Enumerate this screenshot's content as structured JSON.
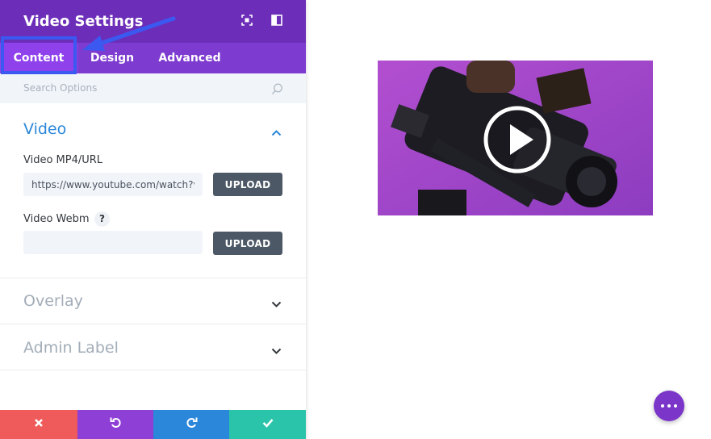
{
  "panel": {
    "title": "Video Settings",
    "tabs": [
      {
        "label": "Content",
        "active": true
      },
      {
        "label": "Design",
        "active": false
      },
      {
        "label": "Advanced",
        "active": false
      }
    ],
    "search": {
      "placeholder": "Search Options"
    },
    "sections": {
      "video": {
        "title": "Video",
        "expanded": true,
        "fields": {
          "mp4": {
            "label": "Video MP4/URL",
            "value": "https://www.youtube.com/watch?v",
            "button": "UPLOAD"
          },
          "webm": {
            "label": "Video Webm",
            "help": "?",
            "value": "",
            "button": "UPLOAD"
          }
        }
      },
      "overlay": {
        "title": "Overlay",
        "expanded": false
      },
      "admin_label": {
        "title": "Admin Label",
        "expanded": false
      }
    },
    "footer": {
      "buttons": [
        {
          "name": "cancel",
          "icon": "close-icon",
          "color": "#ef5a5a"
        },
        {
          "name": "undo",
          "icon": "undo-icon",
          "color": "#8e3fd6"
        },
        {
          "name": "redo",
          "icon": "redo-icon",
          "color": "#2b87da"
        },
        {
          "name": "save",
          "icon": "check-icon",
          "color": "#29c4a9"
        }
      ]
    }
  },
  "colors": {
    "header": "#6c2eb9",
    "tabs": "#7e3bd0",
    "active_tab": "#8f42ec",
    "accent_blue": "#2b87da",
    "highlight": "#3b59f0",
    "muted_title": "#a3adb8"
  },
  "preview": {
    "play_icon": "play-icon"
  },
  "fab": {
    "icon": "more-dots-icon"
  }
}
